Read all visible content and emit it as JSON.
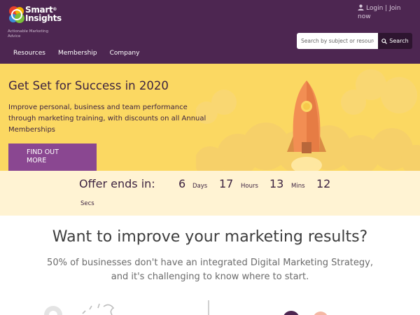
{
  "brand": {
    "name_line1": "Smart",
    "name_line2": "Insights",
    "registered": "®",
    "tagline_line1": "Actionable Marketing",
    "tagline_line2": "Advice",
    "colors": {
      "header": "#4d2651",
      "hero": "#fbd862",
      "button": "#8a4791",
      "offer_bar": "#fff3d3"
    }
  },
  "account": {
    "icon": "user-icon",
    "login": "Login",
    "separator": "|",
    "join_line1": "Join",
    "join_line2": "now"
  },
  "search": {
    "placeholder": "Search by subject or resource",
    "button_label": "Search",
    "icon": "search-icon"
  },
  "nav": {
    "items": [
      {
        "label": "Resources"
      },
      {
        "label": "Membership"
      },
      {
        "label": "Company"
      }
    ]
  },
  "hero": {
    "title": "Get Set for Success in 2020",
    "text": "Improve personal, business and team performance through marketing training, with discounts on all Annual Memberships",
    "button_line1": "FIND OUT",
    "button_line2": "MORE",
    "illustration": "rocket-icon"
  },
  "offer": {
    "label": "Offer ends in:",
    "days": "6",
    "days_unit": "Days",
    "hours": "17",
    "hours_unit": "Hours",
    "mins": "13",
    "mins_unit": "Mins",
    "secs": "12",
    "secs_unit": "Secs"
  },
  "main": {
    "title": "Want to improve your marketing results?",
    "subtitle": "50% of businesses don't have an integrated Digital Marketing Strategy, and it's challenging to know where to start."
  }
}
